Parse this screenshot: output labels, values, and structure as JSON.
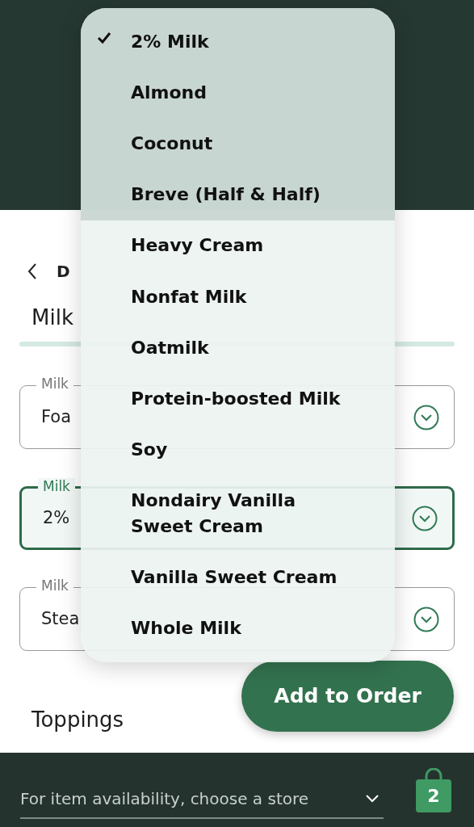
{
  "back_link": {
    "label": "D"
  },
  "section": {
    "title": "Milk"
  },
  "fields": [
    {
      "label": "Milk",
      "value": "Foa",
      "focused": false
    },
    {
      "label": "Milk",
      "value": "2%",
      "focused": true
    },
    {
      "label": "Milk",
      "value": "Stea",
      "focused": false
    }
  ],
  "menu": {
    "items": [
      {
        "label": "2% Milk",
        "selected": true
      },
      {
        "label": "Almond",
        "selected": false
      },
      {
        "label": "Coconut",
        "selected": false
      },
      {
        "label": "Breve (Half & Half)",
        "selected": false
      },
      {
        "label": "Heavy Cream",
        "selected": false
      },
      {
        "label": "Nonfat Milk",
        "selected": false
      },
      {
        "label": "Oatmilk",
        "selected": false
      },
      {
        "label": "Protein-boosted Milk",
        "selected": false
      },
      {
        "label": "Soy",
        "selected": false
      },
      {
        "label": "Nondairy Vanilla Sweet Cream",
        "selected": false
      },
      {
        "label": "Vanilla Sweet Cream",
        "selected": false
      },
      {
        "label": "Whole Milk",
        "selected": false
      }
    ]
  },
  "add_button": {
    "label": "Add to Order"
  },
  "next_section": {
    "title": "Toppings"
  },
  "footer": {
    "store_prompt": "For item availability, choose a store",
    "cart_count": "2"
  }
}
